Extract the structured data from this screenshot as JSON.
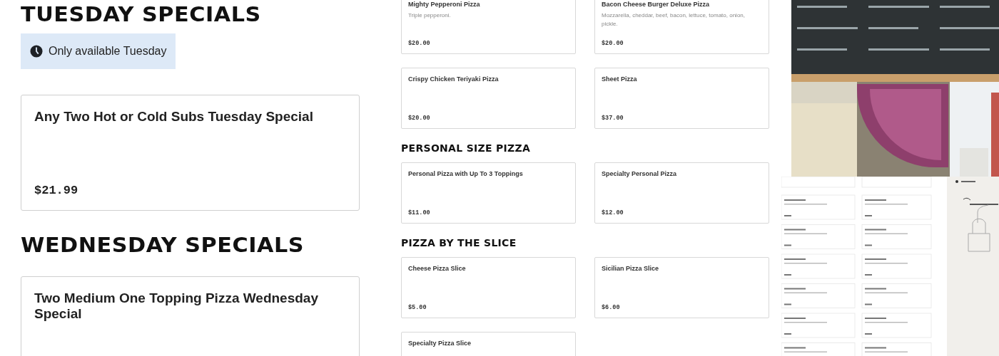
{
  "specials": [
    {
      "title": "TUESDAY SPECIALS",
      "availability": "Only available Tuesday",
      "items": [
        {
          "name": "Any Two Hot or Cold Subs Tuesday Special",
          "price": "$21.99"
        }
      ]
    },
    {
      "title": "WEDNESDAY SPECIALS",
      "items": [
        {
          "name": "Two Medium One Topping Pizza Wednesday Special"
        }
      ]
    }
  ],
  "menu_groups": [
    {
      "items": [
        {
          "name": "Mighty Pepperoni Pizza",
          "description": "Triple pepperoni.",
          "price": "$20.00"
        },
        {
          "name": "Bacon Cheese Burger Deluxe Pizza",
          "description": "Mozzarella, cheddar, beef, bacon, lettuce, tomato, onion, pickle.",
          "price": "$20.00"
        },
        {
          "name": "Crispy Chicken Teriyaki Pizza",
          "price": "$20.00"
        },
        {
          "name": "Sheet Pizza",
          "price": "$37.00"
        }
      ]
    },
    {
      "title": "PERSONAL SIZE PIZZA",
      "items": [
        {
          "name": "Personal Pizza with Up To 3 Toppings",
          "price": "$11.00"
        },
        {
          "name": "Specialty Personal Pizza",
          "price": "$12.00"
        }
      ]
    },
    {
      "title": "PIZZA BY THE SLICE",
      "items": [
        {
          "name": "Cheese Pizza Slice",
          "price": "$5.00"
        },
        {
          "name": "Sicilian Pizza Slice",
          "price": "$6.00"
        },
        {
          "name": "Specialty Pizza Slice"
        }
      ]
    }
  ]
}
